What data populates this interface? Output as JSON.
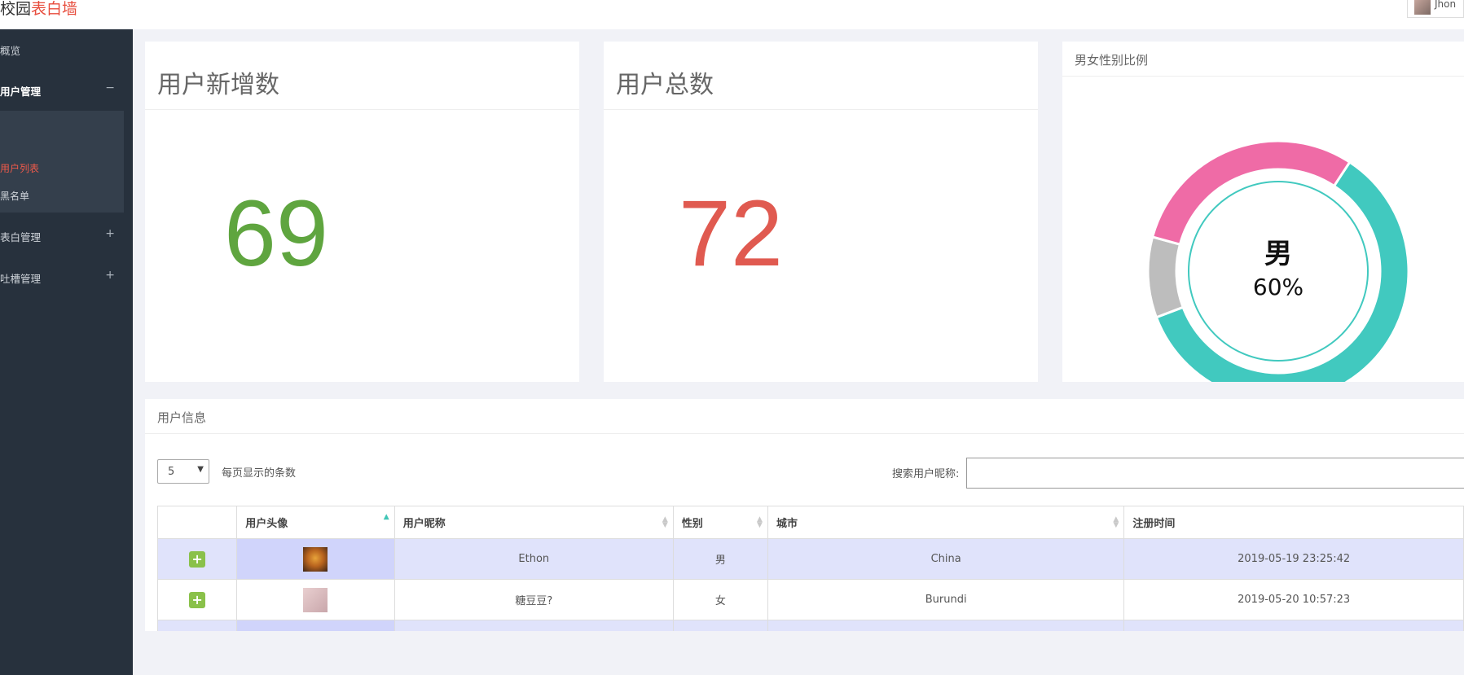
{
  "header": {
    "brand_part1": "校园",
    "brand_part2": "表白墙",
    "user_name": "Jhon"
  },
  "sidebar": {
    "items": [
      {
        "label": "概览"
      },
      {
        "label": "用户管理",
        "sign": "−"
      },
      {
        "label": "表白管理",
        "sign": "+"
      },
      {
        "label": "吐槽管理",
        "sign": "+"
      }
    ],
    "sub_items": [
      {
        "label": "用户列表"
      },
      {
        "label": "黑名单"
      }
    ]
  },
  "cards": {
    "new_users": {
      "title": "用户新增数",
      "value": "69",
      "color": "#5fa53f"
    },
    "total_users": {
      "title": "用户总数",
      "value": "72",
      "color": "#e05a50"
    },
    "gender": {
      "title": "男女性别比例",
      "center_label": "男",
      "center_value": "60%"
    }
  },
  "chart_data": {
    "type": "pie",
    "title": "男女性别比例",
    "slices": [
      {
        "name": "男",
        "value": 60,
        "color": "#41c9bf"
      },
      {
        "name": "",
        "value": 10,
        "color": "#bdbdbd"
      },
      {
        "name": "",
        "value": 30,
        "color": "#ef6ba6"
      }
    ]
  },
  "table_panel": {
    "title": "用户信息",
    "page_size": "5",
    "per_page_label": "每页显示的条数",
    "search_label": "搜索用户昵称:",
    "search_value": "",
    "columns": [
      "",
      "用户头像",
      "用户昵称",
      "性别",
      "城市",
      "注册时间"
    ],
    "rows": [
      {
        "nickname": "Ethon",
        "gender": "男",
        "city": "China",
        "registered": "2019-05-19 23:25:42"
      },
      {
        "nickname": "糖豆豆?",
        "gender": "女",
        "city": "Burundi",
        "registered": "2019-05-20 10:57:23"
      }
    ],
    "expand_label": "+"
  }
}
